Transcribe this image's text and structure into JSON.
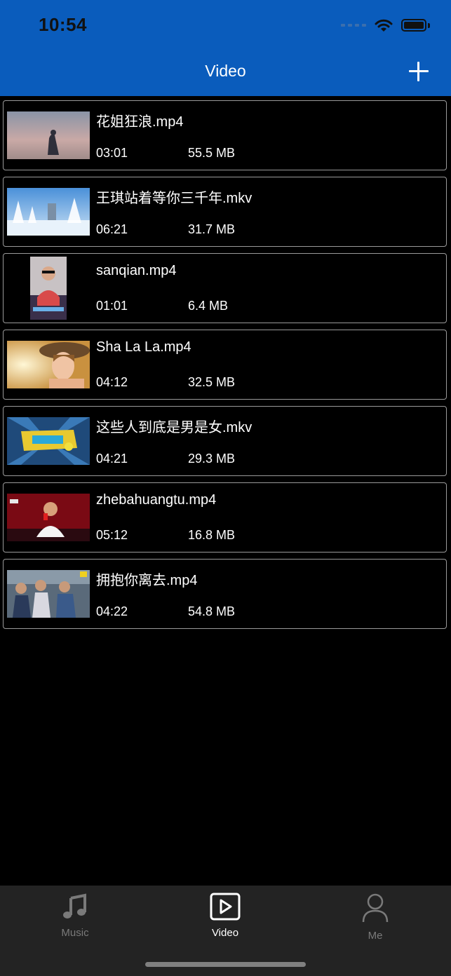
{
  "status_bar": {
    "time": "10:54"
  },
  "nav": {
    "title": "Video"
  },
  "videos": [
    {
      "title": "花姐狂浪.mp4",
      "duration": "03:01",
      "size": "55.5 MB"
    },
    {
      "title": "王琪站着等你三千年.mkv",
      "duration": "06:21",
      "size": "31.7 MB"
    },
    {
      "title": "sanqian.mp4",
      "duration": "01:01",
      "size": "6.4 MB"
    },
    {
      "title": "Sha La La.mp4",
      "duration": "04:12",
      "size": "32.5 MB"
    },
    {
      "title": "这些人到底是男是女.mkv",
      "duration": "04:21",
      "size": "29.3 MB"
    },
    {
      "title": "zhebahuangtu.mp4",
      "duration": "05:12",
      "size": "16.8 MB"
    },
    {
      "title": "拥抱你离去.mp4",
      "duration": "04:22",
      "size": "54.8 MB"
    }
  ],
  "tabs": [
    {
      "label": "Music",
      "icon": "music-note-icon",
      "active": false
    },
    {
      "label": "Video",
      "icon": "play-square-icon",
      "active": true
    },
    {
      "label": "Me",
      "icon": "person-icon",
      "active": false
    }
  ],
  "colors": {
    "header": "#0a5cbc",
    "background": "#000000",
    "tabbar": "#232323",
    "inactive": "#7a7a7a"
  }
}
